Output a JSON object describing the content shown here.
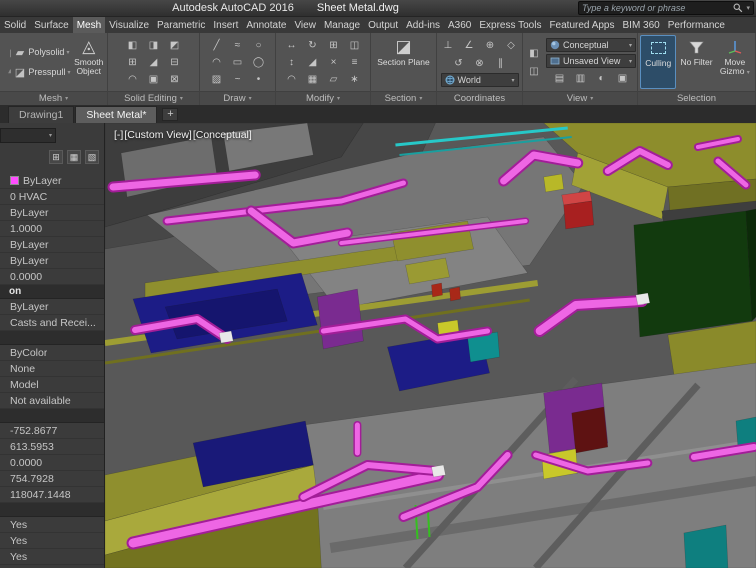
{
  "titlebar": {
    "app": "Autodesk AutoCAD 2016",
    "doc": "Sheet Metal.dwg",
    "search_placeholder": "Type a keyword or phrase"
  },
  "ribbon": {
    "tabs": [
      "Solid",
      "Surface",
      "Mesh",
      "Visualize",
      "Parametric",
      "Insert",
      "Annotate",
      "View",
      "Manage",
      "Output",
      "Add-ins",
      "A360",
      "Express Tools",
      "Featured Apps",
      "BIM 360",
      "Performance"
    ],
    "active_tab": "Mesh",
    "panel_labels": [
      "Mesh",
      "Solid Editing",
      "Draw",
      "Modify",
      "Section",
      "Coordinates",
      "View",
      "Selection"
    ],
    "buttons": {
      "polysolid": "Polysolid",
      "presspull": "Presspull",
      "smooth_object": "Smooth Object",
      "section_plane": "Section Plane",
      "culling": "Culling",
      "no_filter": "No Filter",
      "move_gizmo": "Move Gizmo"
    },
    "dropdowns": {
      "visual_style": "Conceptual",
      "view": "Unsaved View",
      "ucs": "World"
    }
  },
  "file_tabs": {
    "tabs": [
      "Drawing1",
      "Sheet Metal*"
    ],
    "active": "Sheet Metal*",
    "new_label": "+"
  },
  "palette": {
    "swatch_color": "#ff4dff",
    "rows": [
      {
        "v": "ByLayer"
      },
      {
        "v": "0 HVAC"
      },
      {
        "v": "ByLayer"
      },
      {
        "v": "1.0000"
      },
      {
        "v": "ByLayer"
      },
      {
        "v": "ByLayer"
      },
      {
        "v": "0.0000"
      },
      {
        "v": "on"
      },
      {
        "v": "ByLayer"
      },
      {
        "v": "Casts and Recei..."
      },
      {
        "v": ""
      },
      {
        "v": "ByColor"
      },
      {
        "v": "None"
      },
      {
        "v": "Model"
      },
      {
        "v": "Not available"
      },
      {
        "v": ""
      },
      {
        "v": "-752.8677"
      },
      {
        "v": "613.5953"
      },
      {
        "v": "0.0000"
      },
      {
        "v": "754.7928"
      },
      {
        "v": "118047.1448"
      },
      {
        "v": ""
      },
      {
        "v": "Yes"
      },
      {
        "v": "Yes"
      },
      {
        "v": "Yes"
      }
    ]
  },
  "viewport": {
    "menu": "[-]",
    "view": "[Custom View]",
    "style": "[Conceptual]"
  },
  "icons": {
    "caret": "▾",
    "modeling_cut": [
      "▮",
      "▰"
    ],
    "polysolid": "▰",
    "presspull": "◪",
    "smooth_object": "◬",
    "section_plane": "◪",
    "solid_editing": [
      "◧",
      "◨",
      "◩",
      "⊞",
      "◢",
      "⊟",
      "◠",
      "▣",
      "⊠"
    ],
    "draw": [
      "╱",
      "≈",
      "○",
      "◠",
      "▭",
      "◯",
      "▨",
      "~",
      "•"
    ],
    "modify": [
      "↔",
      "↻",
      "⊞",
      "◫",
      "↕",
      "◢",
      "×",
      "≡",
      "◠",
      "▦",
      "▱",
      "∗"
    ],
    "coordinates": [
      "⊥",
      "∠",
      "⊕",
      "◇",
      "↺",
      "⊗",
      "∥"
    ],
    "view_side": [
      "◧",
      "◫"
    ],
    "view_row": [
      "▤",
      "▥",
      "◐",
      "▣"
    ],
    "palette_tools": [
      "⊞",
      "▦",
      "▧"
    ]
  },
  "colors": {
    "duct_magenta": "#ee66e4",
    "wall_olive": "#8f8f2e",
    "floor_gray": "#7a7a7a",
    "room_navy": "#1c1c86",
    "panel_green": "#123a0e",
    "accent_purple": "#7a2b90",
    "accent_cyan": "#19b9b9",
    "selection_highlight": "#2d4d68"
  }
}
